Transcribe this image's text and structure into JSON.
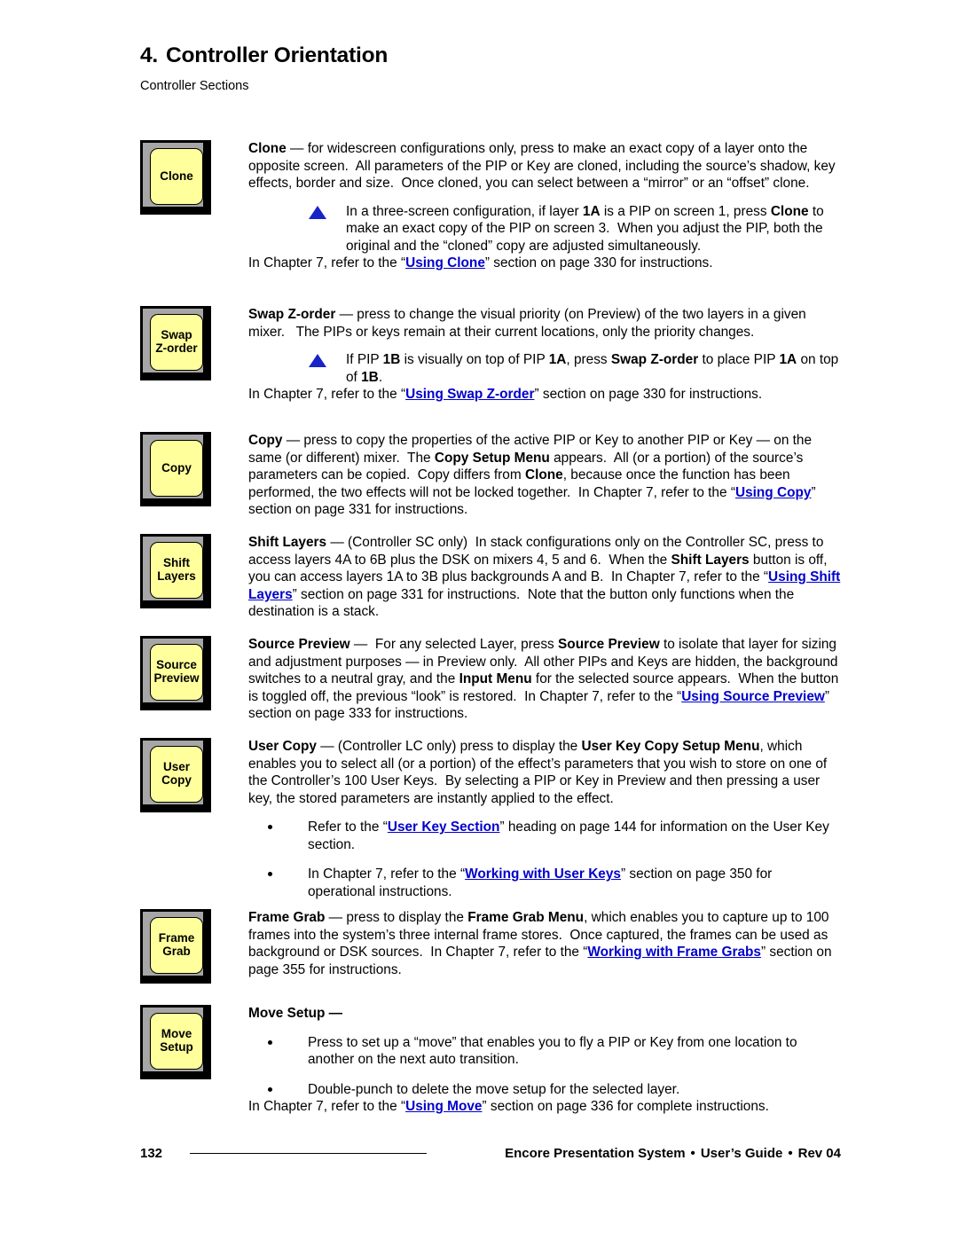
{
  "header": {
    "chapter_number": "4.",
    "chapter_title": "Controller Orientation",
    "section_subtitle": "Controller Sections"
  },
  "sections": [
    {
      "key_label_lines": [
        "Clone"
      ],
      "heading": "Clone",
      "body": "Clone — for widescreen configurations only, press to make an exact copy of a layer onto the opposite screen.  All parameters of the PIP or Key are cloned, including the source’s shadow, key effects, border and size.  Once cloned, you can select between a “mirror” or an “offset” clone.",
      "note": "In a three-screen configuration, if layer 1A is a PIP on screen 1, press Clone to make an exact copy of the PIP on screen 3.  When you adjust the PIP, both the original and the “cloned” copy are adjusted simultaneously.",
      "reference": "In Chapter 7, refer to the “Using Clone” section on page 330 for instructions.",
      "link_text": "Using Clone",
      "page_ref": "330"
    },
    {
      "key_label_lines": [
        "Swap",
        "Z-order"
      ],
      "heading": "Swap Z-order",
      "body": "Swap Z-order — press to change the visual priority (on Preview) of the two layers in a given mixer.   The PIPs or keys remain at their current locations, only the priority changes.",
      "note": "If PIP 1B is visually on top of PIP 1A, press Swap Z-order to place PIP 1A on top of 1B.",
      "reference": "In Chapter 7, refer to the “Using Swap Z-order” section on page 330 for instructions.",
      "link_text": "Using Swap Z-order",
      "page_ref": "330"
    },
    {
      "key_label_lines": [
        "Copy"
      ],
      "heading": "Copy",
      "body": "Copy — press to copy the properties of the active PIP or Key to another PIP or Key — on the same (or different) mixer.  The Copy Setup Menu appears.  All (or a portion) of the source’s parameters can be copied.  Copy differs from Clone, because once the function has been performed, the two effects will not be locked together.  In Chapter 7, refer to the “Using Copy” section on page 331 for instructions.",
      "link_text": "Using Copy",
      "page_ref": "331"
    },
    {
      "key_label_lines": [
        "Shift",
        "Layers"
      ],
      "heading": "Shift Layers",
      "body": "Shift Layers — (Controller SC only)  In stack configurations only on the Controller SC, press to access layers 4A to 6B plus the DSK on mixers 4, 5 and 6.  When the Shift Layers button is off, you can access layers 1A to 3B plus backgrounds A and B.  In Chapter 7, refer to the “Using Shift Layers” section on page 331 for instructions.  Note that the button only functions when the destination is a stack.",
      "link_text": "Using Shift Layers",
      "page_ref": "331"
    },
    {
      "key_label_lines": [
        "Source",
        "Preview"
      ],
      "heading": "Source Preview",
      "body": "Source Preview —  For any selected Layer, press Source Preview to isolate that layer for sizing and adjustment purposes — in Preview only.  All other PIPs and Keys are hidden, the background switches to a neutral gray, and the Input Menu for the selected source appears.  When the button is toggled off, the previous “look” is restored.  In Chapter 7, refer to the “Using Source Preview” section on page 333 for instructions.",
      "link_text": "Using Source Preview",
      "page_ref": "333"
    },
    {
      "key_label_lines": [
        "User",
        "Copy"
      ],
      "heading": "User Copy",
      "body": "User Copy — (Controller LC only) press to display the User Key Copy Setup Menu, which enables you to select all (or a portion) of the effect’s parameters that you wish to store on one of the Controller’s 100 User Keys.  By selecting a PIP or Key in Preview and then pressing a user key, the stored parameters are instantly applied to the effect.",
      "bullets": [
        "Refer to the “User Key Section” heading on page 144 for information on the User Key section.",
        "In Chapter 7, refer to the “Working with User Keys” section on page 350 for operational instructions."
      ],
      "bullet_links": [
        "User Key Section",
        "Working with User Keys"
      ]
    },
    {
      "key_label_lines": [
        "Frame",
        "Grab"
      ],
      "heading": "Frame Grab",
      "body": "Frame Grab — press to display the Frame Grab Menu, which enables you to capture up to 100 frames into the system’s three internal frame stores.  Once captured, the frames can be used as background or DSK sources.  In Chapter 7, refer to the “Working with Frame Grabs” section on page 355 for instructions.",
      "link_text": "Working with Frame Grabs",
      "page_ref": "355"
    },
    {
      "key_label_lines": [
        "Move",
        "Setup"
      ],
      "heading": "Move Setup —",
      "bullets": [
        "Press to set up a “move” that enables you to fly a PIP or Key from one location to another on the next auto transition.",
        "Double-punch to delete the move setup for the selected layer."
      ],
      "reference": "In Chapter 7, refer to the “Using Move” section on page 336 for complete instructions.",
      "link_text": "Using Move",
      "page_ref": "336"
    }
  ],
  "footer": {
    "page_number": "132",
    "product": "Encore Presentation System",
    "guide": "User’s Guide",
    "revision": "Rev 04",
    "separator": "•"
  },
  "colors": {
    "link": "#0000CC",
    "note_triangle": "#1823C8",
    "key_cap": "#FFFF9C",
    "key_bevel": "#A6A6A6",
    "key_shadow": "#000000"
  }
}
